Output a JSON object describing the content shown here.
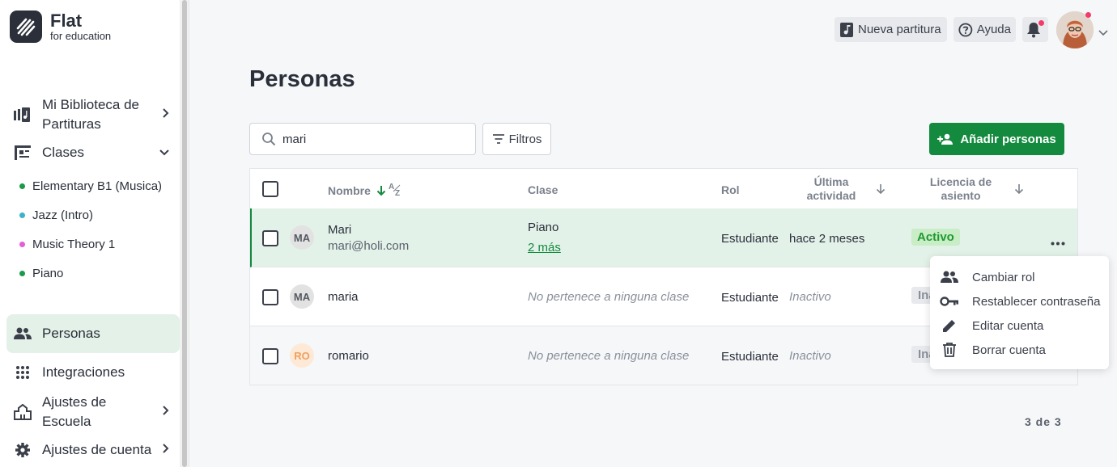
{
  "brand": {
    "name": "Flat",
    "tagline": "for education"
  },
  "sidebar": {
    "library_label": "Mi Biblioteca de Partituras",
    "classes_label": "Clases",
    "classes": [
      {
        "label": "Elementary B1  (Musica)",
        "color": "#1a9a4a"
      },
      {
        "label": "Jazz  (Intro)",
        "color": "#3bb2c9"
      },
      {
        "label": "Music Theory 1",
        "color": "#e35ed8"
      },
      {
        "label": "Piano",
        "color": "#1a9a4a"
      }
    ],
    "people_label": "Personas",
    "integrations_label": "Integraciones",
    "school_settings_label": "Ajustes de Escuela",
    "account_settings_label": "Ajustes de cuenta"
  },
  "topbar": {
    "new_score_label": "Nueva partitura",
    "help_label": "Ayuda"
  },
  "page": {
    "title": "Personas",
    "search_value": "mari",
    "filters_label": "Filtros",
    "add_people_label": "Añadir personas"
  },
  "table": {
    "headers": {
      "name": "Nombre",
      "class": "Clase",
      "role": "Rol",
      "last_activity_1": "Última",
      "last_activity_2": "actividad",
      "license_1": "Licencia de",
      "license_2": "asiento"
    },
    "rows": [
      {
        "initials": "MA",
        "name": "Mari",
        "email": "mari@holi.com",
        "class": "Piano",
        "class_more": "2 más",
        "role": "Estudiante",
        "activity": "hace 2 meses",
        "license": "Activo"
      },
      {
        "initials": "MA",
        "name": "maria",
        "class": "No pertenece a ninguna clase",
        "role": "Estudiante",
        "activity": "Inactivo",
        "license": "Inactivo"
      },
      {
        "initials": "RO",
        "name": "romario",
        "class": "No pertenece a ninguna clase",
        "role": "Estudiante",
        "activity": "Inactivo",
        "license": "Inactivo"
      }
    ]
  },
  "menu": {
    "items": [
      {
        "label": "Cambiar rol",
        "icon": "people-icon"
      },
      {
        "label": "Restablecer contraseña",
        "icon": "key-icon"
      },
      {
        "label": "Editar cuenta",
        "icon": "pencil-icon"
      },
      {
        "label": "Borrar cuenta",
        "icon": "trash-icon"
      }
    ]
  },
  "pagination": {
    "text": "3 de 3"
  },
  "colors": {
    "accent": "#138a3e",
    "active_badge": "#c8edc7"
  }
}
